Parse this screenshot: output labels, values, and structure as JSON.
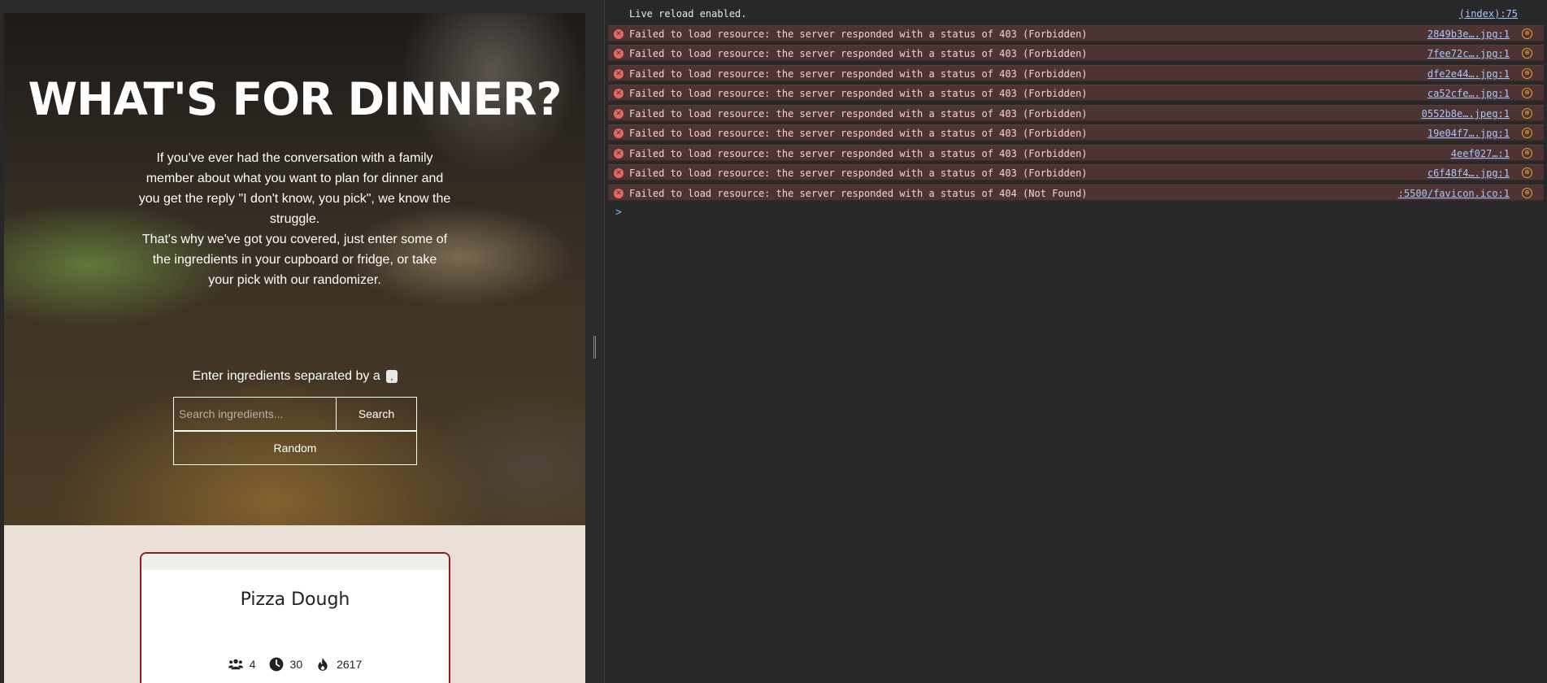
{
  "site": {
    "hero": {
      "title": "WHAT'S FOR DINNER?",
      "description_1": "If you've ever had the conversation with a family member about what you want to plan for dinner and you get the reply \"I don't know, you pick\", we know the struggle.",
      "description_2": "That's why we've got you covered, just enter some of the ingredients in your cupboard or fridge, or take your pick with our randomizer.",
      "ingredients_label": "Enter ingredients separated by a",
      "separator_badge": ",",
      "search_placeholder": "Search ingredients...",
      "search_label": "Search",
      "random_label": "Random"
    },
    "recipe_card": {
      "title": "Pizza Dough",
      "servings": "4",
      "time": "30",
      "calories": "2617",
      "icons": [
        "users-icon",
        "clock-icon",
        "flame-icon"
      ]
    }
  },
  "console": {
    "info": {
      "message": "Live reload enabled.",
      "source": "(index):75"
    },
    "errors": [
      {
        "message": "Failed to load resource: the server responded with a status of 403 (Forbidden)",
        "source": "2849b3e….jpg:1"
      },
      {
        "message": "Failed to load resource: the server responded with a status of 403 (Forbidden)",
        "source": "7fee72c….jpg:1"
      },
      {
        "message": "Failed to load resource: the server responded with a status of 403 (Forbidden)",
        "source": "dfe2e44….jpg:1"
      },
      {
        "message": "Failed to load resource: the server responded with a status of 403 (Forbidden)",
        "source": "ca52cfe….jpg:1"
      },
      {
        "message": "Failed to load resource: the server responded with a status of 403 (Forbidden)",
        "source": "0552b8e….jpeg:1"
      },
      {
        "message": "Failed to load resource: the server responded with a status of 403 (Forbidden)",
        "source": "19e04f7….jpg:1"
      },
      {
        "message": "Failed to load resource: the server responded with a status of 403 (Forbidden)",
        "source": "4eef027…:1"
      },
      {
        "message": "Failed to load resource: the server responded with a status of 403 (Forbidden)",
        "source": "c6f48f4….jpg:1"
      },
      {
        "message": "Failed to load resource: the server responded with a status of 404 (Not Found)",
        "source": ":5500/favicon.ico:1"
      }
    ],
    "prompt_symbol": ">"
  },
  "colors": {
    "card_border": "#8f1d1d",
    "error_row_bg": "#4e3333",
    "error_icon": "#e46962",
    "link": "#a8c7fa",
    "network_icon": "#e9a23b",
    "page_bg": "#ebe0d6"
  }
}
